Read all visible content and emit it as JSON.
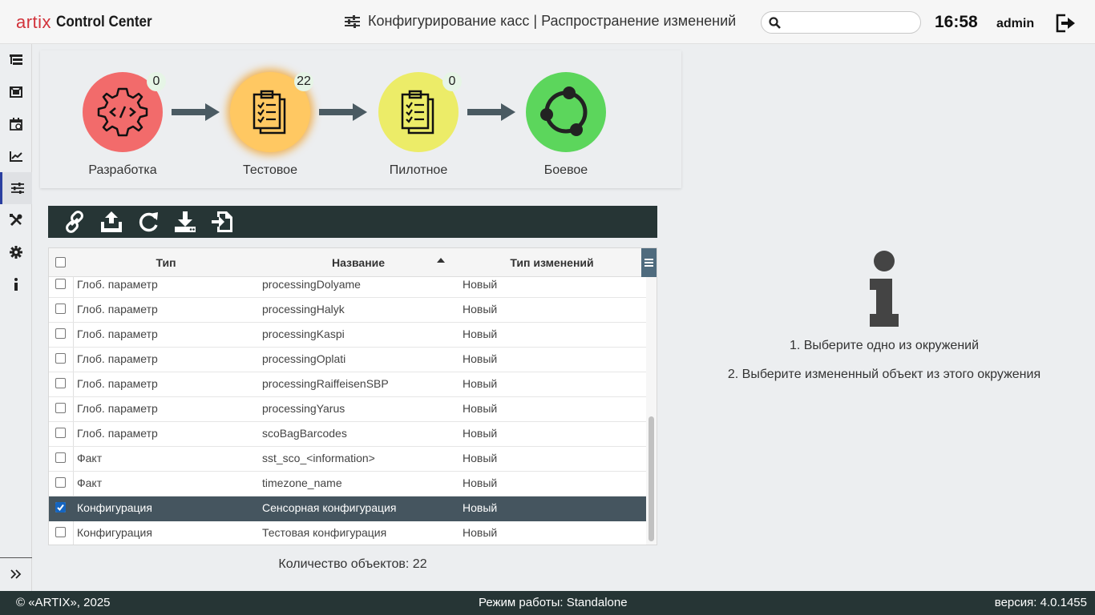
{
  "header": {
    "logo_text": "artix",
    "app_name": "Control Center",
    "title": "Конфигурирование касс | Распространение изменений",
    "search_placeholder": "",
    "time": "16:58",
    "user": "admin"
  },
  "sidebar": {
    "items": [
      "tree-icon",
      "frame-icon",
      "calendar-icon",
      "chart-icon",
      "sliders-icon",
      "tools-icon",
      "gear-icon",
      "info-icon"
    ],
    "active_index": 4
  },
  "pipeline": {
    "stages": [
      {
        "label": "Разработка",
        "count": "0",
        "color": "#f26b6b"
      },
      {
        "label": "Тестовое",
        "count": "22",
        "color": "#ffc862"
      },
      {
        "label": "Пилотное",
        "count": "0",
        "color": "#ecec68"
      },
      {
        "label": "Боевое",
        "count": "",
        "color": "#5cd65c"
      }
    ]
  },
  "toolbar": {
    "buttons": [
      "link-icon",
      "upload-icon",
      "refresh-icon",
      "download-icon",
      "import-icon"
    ]
  },
  "table": {
    "columns": [
      "Тип",
      "Название",
      "Тип изменений"
    ],
    "sort_column": "Название",
    "rows": [
      {
        "type": "Глоб. параметр",
        "name": "processingDolyame",
        "change": "Новый",
        "checked": false
      },
      {
        "type": "Глоб. параметр",
        "name": "processingHalyk",
        "change": "Новый",
        "checked": false
      },
      {
        "type": "Глоб. параметр",
        "name": "processingKaspi",
        "change": "Новый",
        "checked": false
      },
      {
        "type": "Глоб. параметр",
        "name": "processingOplati",
        "change": "Новый",
        "checked": false
      },
      {
        "type": "Глоб. параметр",
        "name": "processingRaiffeisenSBP",
        "change": "Новый",
        "checked": false
      },
      {
        "type": "Глоб. параметр",
        "name": "processingYarus",
        "change": "Новый",
        "checked": false
      },
      {
        "type": "Глоб. параметр",
        "name": "scoBagBarcodes",
        "change": "Новый",
        "checked": false
      },
      {
        "type": "Факт",
        "name": "sst_sco_<information>",
        "change": "Новый",
        "checked": false
      },
      {
        "type": "Факт",
        "name": "timezone_name",
        "change": "Новый",
        "checked": false
      },
      {
        "type": "Конфигурация",
        "name": "Сенсорная конфигурация",
        "change": "Новый",
        "checked": true
      },
      {
        "type": "Конфигурация",
        "name": "Тестовая конфигурация",
        "change": "Новый",
        "checked": false
      }
    ],
    "selected_index": 9
  },
  "count_text": "Количество объектов: 22",
  "info": {
    "line1": "1. Выберите одно из окружений",
    "line2": "2. Выберите измененный объект из этого окружения"
  },
  "footer": {
    "copyright": "© «ARTIX», 2025",
    "mode": "Режим работы: Standalone",
    "version": "версия: 4.0.1455"
  }
}
